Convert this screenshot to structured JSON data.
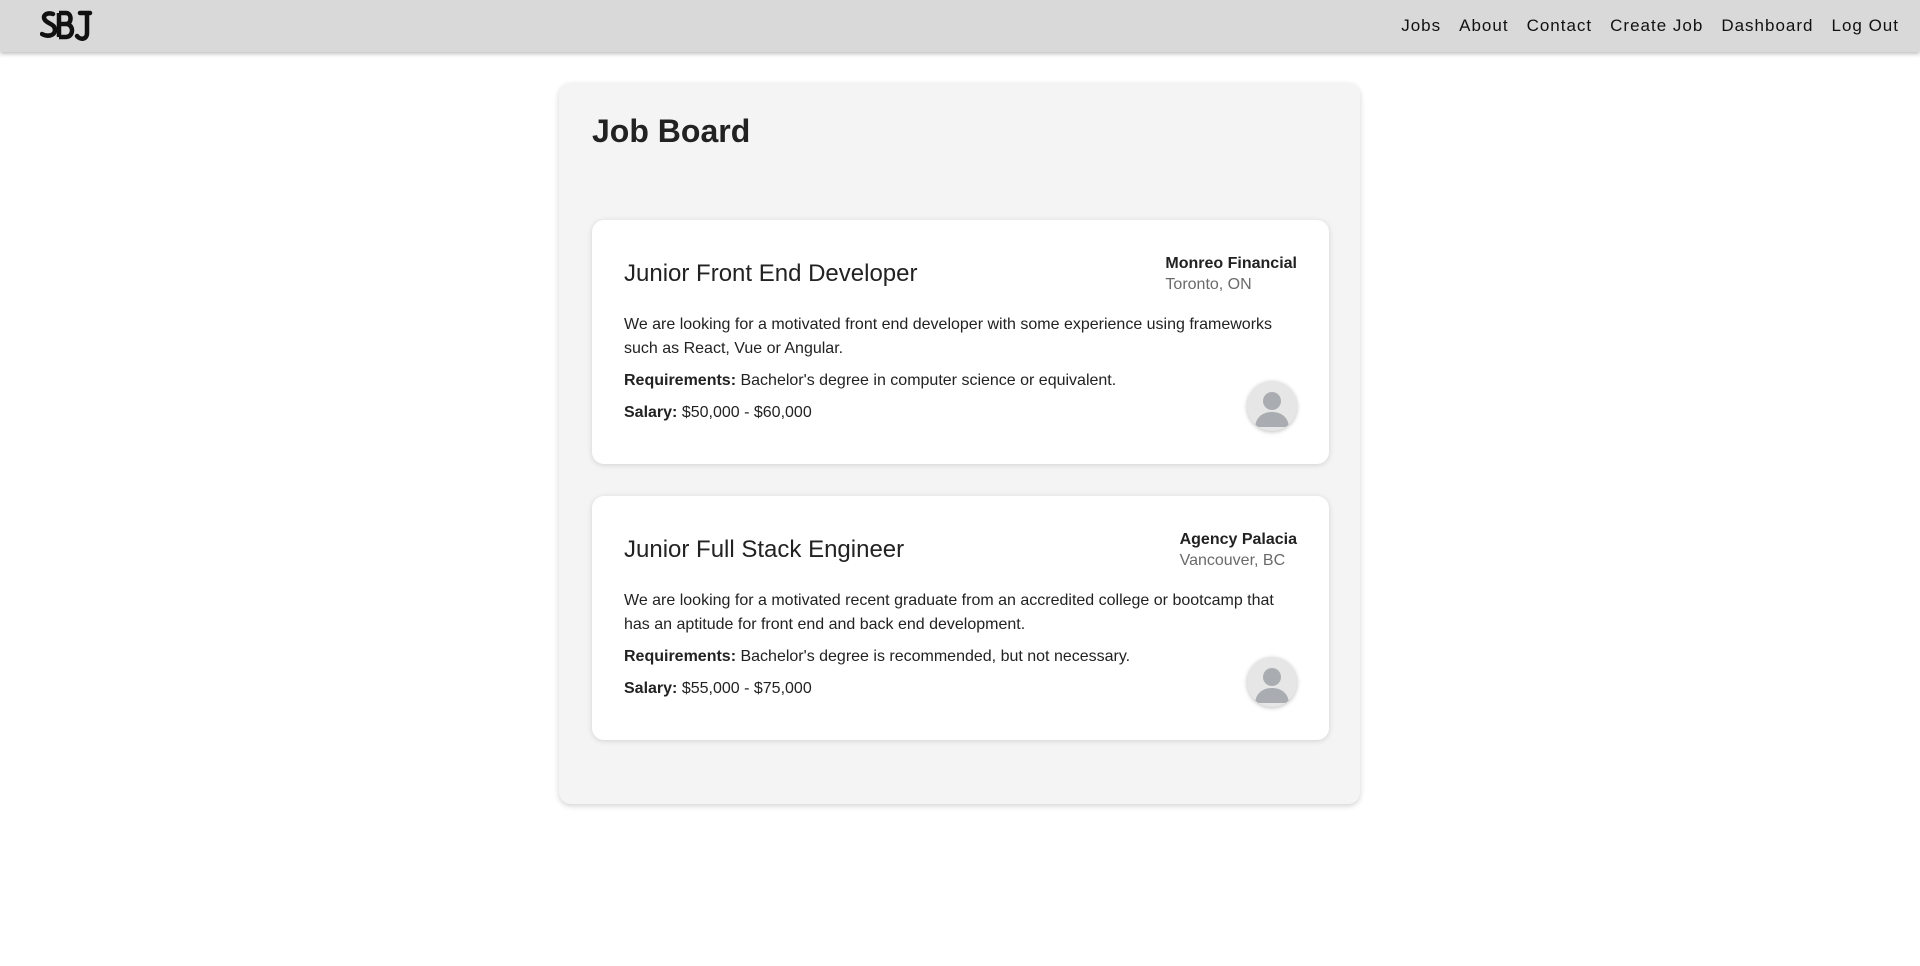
{
  "navbar": {
    "logo_text": "SBJ",
    "links": [
      {
        "label": "Jobs"
      },
      {
        "label": "About"
      },
      {
        "label": "Contact"
      },
      {
        "label": "Create Job"
      },
      {
        "label": "Dashboard"
      },
      {
        "label": "Log Out"
      }
    ]
  },
  "board": {
    "title": "Job Board"
  },
  "jobs": [
    {
      "title": "Junior Front End Developer",
      "company": "Monreo Financial",
      "location": "Toronto, ON",
      "description": "We are looking for a motivated front end developer with some experience using frameworks such as React, Vue or Angular.",
      "requirements_label": "Requirements:",
      "requirements": "Bachelor's degree in computer science or equivalent.",
      "salary_label": "Salary:",
      "salary": "$50,000 - $60,000",
      "avatar_icon": "user-avatar-icon"
    },
    {
      "title": "Junior Full Stack Engineer",
      "company": "Agency Palacia",
      "location": "Vancouver, BC",
      "description": "We are looking for a motivated recent graduate from an accredited college or bootcamp that has an aptitude for front end and back end development.",
      "requirements_label": "Requirements:",
      "requirements": "Bachelor's degree is recommended, but not necessary.",
      "salary_label": "Salary:",
      "salary": "$55,000 - $75,000",
      "avatar_icon": "user-avatar-icon"
    }
  ],
  "colors": {
    "navbar_bg": "#d9d9d9",
    "board_bg": "#f4f4f4",
    "card_bg": "#ffffff",
    "muted_text": "#6a6a6a"
  }
}
